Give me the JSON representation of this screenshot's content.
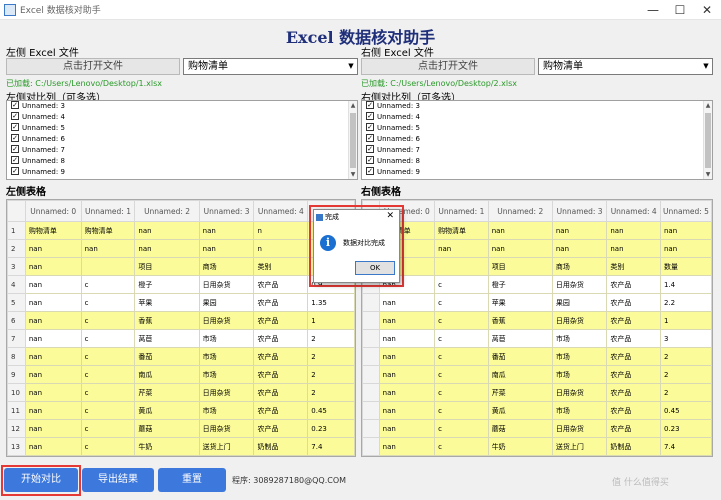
{
  "window": {
    "title": "Excel 数据核对助手",
    "minimize": "—",
    "maximize": "☐",
    "close": "✕"
  },
  "heading": "Excel 数据核对助手",
  "left": {
    "file_label": "左侧 Excel 文件",
    "open_button": "点击打开文件",
    "sheet": "购物清单",
    "loaded_path": "已加载: C:/Users/Lenovo/Desktop/1.xlsx",
    "compare_label": "左侧对比列（可多选）",
    "compare_columns": [
      {
        "label": "Unnamed: 3",
        "checked": true
      },
      {
        "label": "Unnamed: 4",
        "checked": true
      },
      {
        "label": "Unnamed: 5",
        "checked": true
      },
      {
        "label": "Unnamed: 6",
        "checked": true
      },
      {
        "label": "Unnamed: 7",
        "checked": true
      },
      {
        "label": "Unnamed: 8",
        "checked": true
      },
      {
        "label": "Unnamed: 9",
        "checked": true
      }
    ],
    "table_label": "左侧表格",
    "table": {
      "headers": [
        "Unnamed: 0",
        "Unnamed: 1",
        "Unnamed: 2",
        "Unnamed: 3",
        "Unnamed: 4"
      ],
      "rows": [
        {
          "n": "1",
          "hl": true,
          "cells": [
            "购物清单",
            "购物清单",
            "nan",
            "nan",
            "n"
          ]
        },
        {
          "n": "2",
          "hl": true,
          "cells": [
            "nan",
            "nan",
            "nan",
            "nan",
            "n"
          ]
        },
        {
          "n": "3",
          "hl": true,
          "cells": [
            "nan",
            "",
            "项目",
            "商场",
            "类别"
          ]
        },
        {
          "n": "4",
          "hl": false,
          "cells": [
            "nan",
            "c",
            "橙子",
            "日用杂货",
            "农产品"
          ]
        },
        {
          "n": "5",
          "hl": false,
          "cells": [
            "nan",
            "c",
            "苹果",
            "果园",
            "农产品"
          ]
        },
        {
          "n": "6",
          "hl": true,
          "cells": [
            "nan",
            "c",
            "香蕉",
            "日用杂货",
            "农产品"
          ]
        },
        {
          "n": "7",
          "hl": false,
          "cells": [
            "nan",
            "c",
            "莴苣",
            "市场",
            "农产品"
          ]
        },
        {
          "n": "8",
          "hl": true,
          "cells": [
            "nan",
            "c",
            "番茄",
            "市场",
            "农产品"
          ]
        },
        {
          "n": "9",
          "hl": true,
          "cells": [
            "nan",
            "c",
            "南瓜",
            "市场",
            "农产品"
          ]
        },
        {
          "n": "10",
          "hl": true,
          "cells": [
            "nan",
            "c",
            "芹菜",
            "日用杂货",
            "农产品"
          ]
        },
        {
          "n": "11",
          "hl": true,
          "cells": [
            "nan",
            "c",
            "黄瓜",
            "市场",
            "农产品"
          ]
        },
        {
          "n": "12",
          "hl": true,
          "cells": [
            "nan",
            "c",
            "蘑菇",
            "日用杂货",
            "农产品"
          ]
        },
        {
          "n": "13",
          "hl": true,
          "cells": [
            "nan",
            "c",
            "牛奶",
            "送货上门",
            "奶制品"
          ]
        }
      ],
      "overflow_values": [
        "",
        "",
        "",
        "0.9",
        "1.35",
        "1",
        "2",
        "2",
        "2",
        "2",
        "0.45",
        "0.23",
        "7.4"
      ]
    }
  },
  "right": {
    "file_label": "右侧 Excel 文件",
    "open_button": "点击打开文件",
    "sheet": "购物清单",
    "loaded_path": "已加载: C:/Users/Lenovo/Desktop/2.xlsx",
    "compare_label": "右侧对比列（可多选）",
    "compare_columns": [
      {
        "label": "Unnamed: 3",
        "checked": true
      },
      {
        "label": "Unnamed: 4",
        "checked": true
      },
      {
        "label": "Unnamed: 5",
        "checked": true
      },
      {
        "label": "Unnamed: 6",
        "checked": true
      },
      {
        "label": "Unnamed: 7",
        "checked": true
      },
      {
        "label": "Unnamed: 8",
        "checked": true
      },
      {
        "label": "Unnamed: 9",
        "checked": true
      }
    ],
    "table_label": "右侧表格",
    "table": {
      "headers": [
        "Unnamed: 0",
        "Unnamed: 1",
        "Unnamed: 2",
        "Unnamed: 3",
        "Unnamed: 4",
        "Unnamed: 5"
      ],
      "rows": [
        {
          "n": "",
          "hl": true,
          "cells": [
            "购物清单",
            "购物清单",
            "nan",
            "nan",
            "nan",
            "nan"
          ]
        },
        {
          "n": "",
          "hl": true,
          "cells": [
            "nan",
            "nan",
            "nan",
            "nan",
            "nan",
            "nan"
          ]
        },
        {
          "n": "",
          "hl": true,
          "cells": [
            "nan",
            "",
            "项目",
            "商场",
            "类别",
            "数量"
          ]
        },
        {
          "n": "",
          "hl": false,
          "cells": [
            "nan",
            "c",
            "橙子",
            "日用杂货",
            "农产品",
            "1.4"
          ]
        },
        {
          "n": "",
          "hl": false,
          "cells": [
            "nan",
            "c",
            "苹果",
            "果园",
            "农产品",
            "2.2"
          ]
        },
        {
          "n": "",
          "hl": true,
          "cells": [
            "nan",
            "c",
            "香蕉",
            "日用杂货",
            "农产品",
            "1"
          ]
        },
        {
          "n": "",
          "hl": false,
          "cells": [
            "nan",
            "c",
            "莴苣",
            "市场",
            "农产品",
            "3"
          ]
        },
        {
          "n": "",
          "hl": true,
          "cells": [
            "nan",
            "c",
            "番茄",
            "市场",
            "农产品",
            "2"
          ]
        },
        {
          "n": "",
          "hl": true,
          "cells": [
            "nan",
            "c",
            "南瓜",
            "市场",
            "农产品",
            "2"
          ]
        },
        {
          "n": "",
          "hl": true,
          "cells": [
            "nan",
            "c",
            "芹菜",
            "日用杂货",
            "农产品",
            "2"
          ]
        },
        {
          "n": "",
          "hl": true,
          "cells": [
            "nan",
            "c",
            "黄瓜",
            "市场",
            "农产品",
            "0.45"
          ]
        },
        {
          "n": "",
          "hl": true,
          "cells": [
            "nan",
            "c",
            "蘑菇",
            "日用杂货",
            "农产品",
            "0.23"
          ]
        },
        {
          "n": "",
          "hl": true,
          "cells": [
            "nan",
            "c",
            "牛奶",
            "送货上门",
            "奶制品",
            "7.4"
          ]
        }
      ]
    }
  },
  "buttons": {
    "start": "开始对比",
    "export": "导出结果",
    "reset": "重置"
  },
  "author": "程序: 3089287180@QQ.COM",
  "dialog": {
    "title": "完成",
    "close": "✕",
    "message": "数据对比完成",
    "ok": "OK"
  },
  "watermark": "值 什么值得买",
  "colors": {
    "highlight": "#fbfb9a",
    "accent_button": "#3d78dc",
    "heading": "#1f2f7a",
    "path_text": "#2a9a2a",
    "red_box": "#e53935"
  }
}
